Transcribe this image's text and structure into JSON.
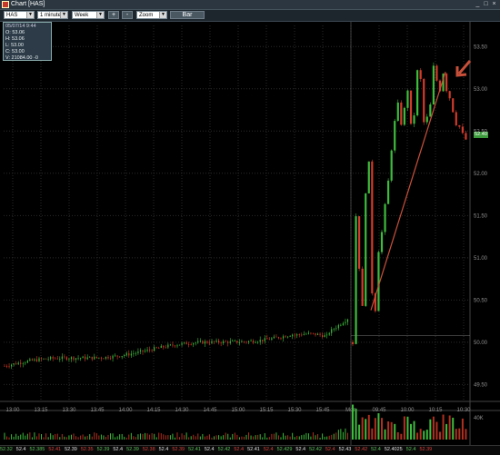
{
  "window": {
    "title": "Chart [HAS]"
  },
  "toolbar": {
    "symbol": "HAS",
    "interval": "1 minute",
    "range": "Week",
    "zoom_in": "+",
    "zoom_out": "-",
    "zoom": "Zoom",
    "bar": "Bar"
  },
  "quote_box": {
    "header": "05/07/14 9:44",
    "open": "O: 53.06",
    "high": "H: 53.06",
    "low": "L: 53.00",
    "close": "C: 53.00",
    "volume": "V: 21084.00 -0"
  },
  "last_price": "52.40",
  "colors": {
    "up": "#3dbb3d",
    "down": "#d23b2b",
    "trend_arrow": "#c8503a",
    "grid": "#2a2a2a",
    "volume": "#b03020"
  },
  "chart_data": {
    "type": "candlestick",
    "y_ticks": [
      "53.50",
      "53.00",
      "52.50",
      "52.00",
      "51.50",
      "51.00",
      "50.50",
      "50.00",
      "49.50"
    ],
    "x_ticks": [
      "13:00",
      "13:15",
      "13:30",
      "13:45",
      "14:00",
      "14:15",
      "14:30",
      "14:45",
      "15:00",
      "15:15",
      "15:30",
      "15:45",
      "Mon",
      "09:45",
      "10:00",
      "10:15",
      "10:30"
    ],
    "volume_label": "40K",
    "ylim": [
      49.3,
      53.75
    ],
    "grid": true,
    "annotations": [
      {
        "type": "trend_line",
        "from": {
          "x": "09:40",
          "y": 50.4
        },
        "to": {
          "x": "10:20",
          "y": 53.2
        }
      },
      {
        "type": "arrow",
        "points_to": {
          "x": "10:21",
          "y": 53.05
        }
      }
    ]
  },
  "footer_values": [
    "52.32",
    "52.4",
    "52.385",
    "52.41",
    "52.39",
    "52.35",
    "52.39",
    "52.4",
    "52.39",
    "52.38",
    "52.4",
    "52.39",
    "52.41",
    "52.4",
    "52.42",
    "52.4",
    "52.41",
    "52.4",
    "52.429",
    "52.4",
    "52.42",
    "52.4",
    "52.43",
    "52.42",
    "52.4",
    "52.4025",
    "52.4",
    "52.39"
  ]
}
